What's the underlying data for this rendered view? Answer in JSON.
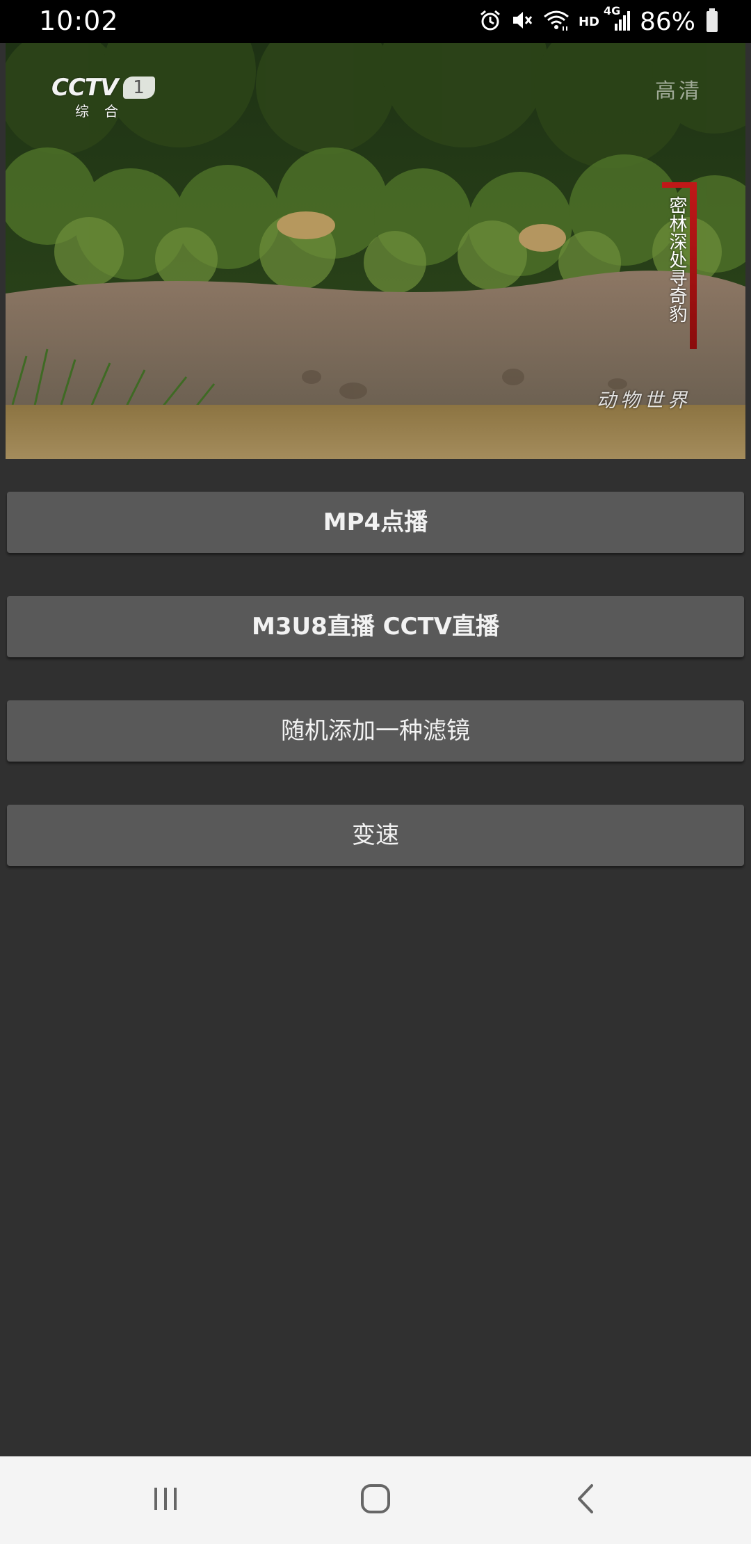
{
  "status_bar": {
    "time": "10:02",
    "icons": [
      "alarm-icon",
      "mute-icon",
      "wifi-icon",
      "signal-icon",
      "battery-icon"
    ],
    "hd_label": "HD",
    "network_label": "4G",
    "battery_text": "86%",
    "battery_level": 0.86
  },
  "video": {
    "channel_logo": "CCTV",
    "channel_number": "1",
    "channel_sub": "综合",
    "quality_badge": "高清",
    "program_title": "密林深处寻奇豹",
    "watermark": "动物世界",
    "colors": {
      "foliage": "#3b5a22",
      "bank": "#8a7a66",
      "water": "#9a8552",
      "title_accent": "#c01818"
    }
  },
  "buttons": {
    "mp4": "MP4点播",
    "m3u8": "M3U8直播 CCTV直播",
    "filter": "随机添加一种滤镜",
    "speed": "变速"
  },
  "nav_bar": {
    "icons": [
      "recents-icon",
      "home-icon",
      "back-icon"
    ]
  },
  "colors": {
    "background": "#303030",
    "button": "#595959",
    "nav_bar": "#f4f4f4"
  }
}
